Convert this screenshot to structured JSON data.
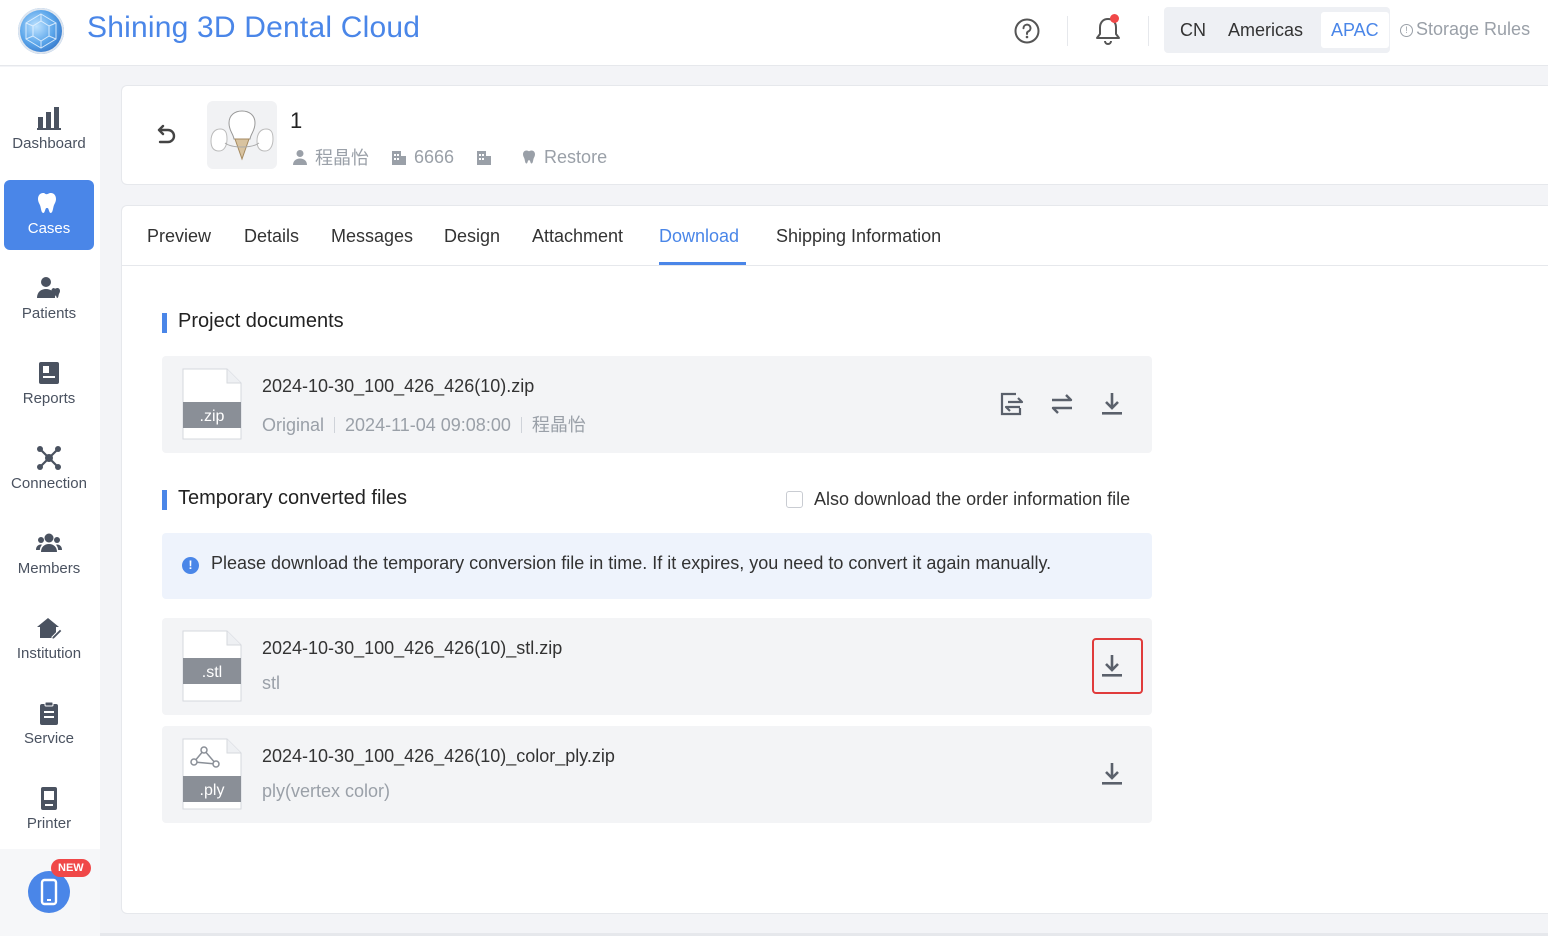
{
  "header": {
    "app_title": "Shining 3D Dental Cloud",
    "regions": [
      "CN",
      "Americas",
      "APAC"
    ],
    "active_region": "APAC",
    "storage_rules": "Storage Rules",
    "help_icon": "help-circle-icon",
    "notification_icon": "bell-icon"
  },
  "sidebar": {
    "items": [
      {
        "label": "Dashboard",
        "icon": "bar-chart-icon"
      },
      {
        "label": "Cases",
        "icon": "tooth-icon",
        "active": true
      },
      {
        "label": "Patients",
        "icon": "patients-icon"
      },
      {
        "label": "Reports",
        "icon": "report-icon"
      },
      {
        "label": "Connection",
        "icon": "connection-icon"
      },
      {
        "label": "Members",
        "icon": "members-icon"
      },
      {
        "label": "Institution",
        "icon": "institution-icon"
      },
      {
        "label": "Service",
        "icon": "clipboard-icon"
      },
      {
        "label": "Printer",
        "icon": "printer-icon"
      }
    ],
    "promo_badge": "NEW"
  },
  "case": {
    "title": "1",
    "doctor": "程晶怡",
    "clinic": "6666",
    "type": "Restore"
  },
  "tabs": [
    "Preview",
    "Details",
    "Messages",
    "Design",
    "Attachment",
    "Download",
    "Shipping Information"
  ],
  "active_tab": "Download",
  "project_documents": {
    "title": "Project documents",
    "files": [
      {
        "ext": ".zip",
        "name": "2024-10-30_100_426_426(10).zip",
        "kind": "Original",
        "date": "2024-11-04 09:08:00",
        "owner": "程晶怡"
      }
    ]
  },
  "temporary_files": {
    "title": "Temporary converted files",
    "checkbox_label": "Also download the order information file",
    "checked": false,
    "notice": "Please download the temporary conversion file in time. If it expires, you need to convert it again manually.",
    "files": [
      {
        "ext": ".stl",
        "name": "2024-10-30_100_426_426(10)_stl.zip",
        "format": "stl"
      },
      {
        "ext": ".ply",
        "name": "2024-10-30_100_426_426(10)_color_ply.zip",
        "format": "ply(vertex color)"
      }
    ]
  },
  "colors": {
    "accent": "#4a86e8",
    "highlight": "#e03b3b"
  }
}
